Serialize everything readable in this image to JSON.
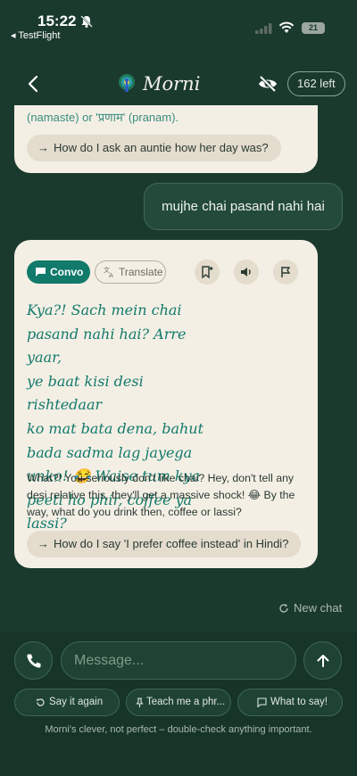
{
  "status_bar": {
    "time": "15:22",
    "back_app": "◂ TestFlight",
    "battery": "21"
  },
  "header": {
    "title": "Morni",
    "counter": "162 left"
  },
  "chat": {
    "prev_fragment": "(namaste) or 'प्रणाम' (pranam).",
    "prev_suggestion": "How do I ask an auntie how her day was?",
    "user_message": "mujhe chai pasand nahi hai",
    "reply": {
      "convo_label": "Convo",
      "translate_label": "Translate",
      "hindi_lines": [
        "Kya?! Sach mein chai",
        "pasand nahi hai? Arre yaar,",
        "ye baat kisi desi rishtedaar",
        "ko mat bata dena, bahut",
        "bada sadma lag jayega",
        "unko! 😂 Waise tum kya",
        "peeti ho phir, coffee ya lassi?"
      ],
      "english": "What?! You seriously don't like chai? Hey, don't tell any desi relative this, they'll get a massive shock! 😂 By the way, what do you drink then, coffee or lassi?",
      "suggestion": "How do I say 'I prefer coffee instead' in Hindi?"
    },
    "new_chat_label": "New chat"
  },
  "composer": {
    "placeholder": "Message...",
    "quick_actions": [
      "Say it again",
      "Teach me a phr...",
      "What to say!"
    ],
    "disclaimer": "Morni's clever, not perfect – double-check anything important."
  },
  "colors": {
    "background": "#1b3a2e",
    "bubble": "#f4efe5",
    "accent": "#127a6b"
  }
}
